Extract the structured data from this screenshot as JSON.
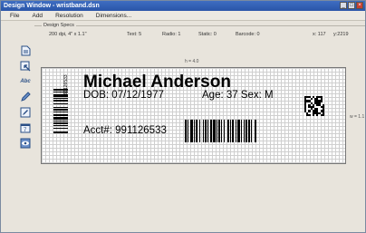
{
  "window": {
    "title": "Design Window - wristband.dsn"
  },
  "menu": [
    "File",
    "Add",
    "Resolution",
    "Dimensions..."
  ],
  "specs": {
    "group_title": "Design Specs",
    "resolution": "200 dpi, 4\" x 1.1\"",
    "text": "Text: 5",
    "radio": "Radio: 1",
    "static": "Static: 0",
    "barcode": "Barcode: 0",
    "x": "x: 117",
    "y": "y:2219"
  },
  "toolbar": [
    "document-icon",
    "arrow-icon",
    "abc-text-icon",
    "pencil-icon",
    "edit-icon",
    "calendar-icon",
    "eye-icon"
  ],
  "toolbar_abc_text": "Abc",
  "toolbar_calendar_text": "7",
  "dimensions": {
    "height": "h = 4.0",
    "width": "w = 1.1"
  },
  "label": {
    "name": "Michael Anderson",
    "dob": "DOB: 07/12/1977",
    "age_sex": "Age: 37 Sex: M",
    "account": "Acct#: 991126533",
    "vertical_barcode_text": "991126533"
  }
}
